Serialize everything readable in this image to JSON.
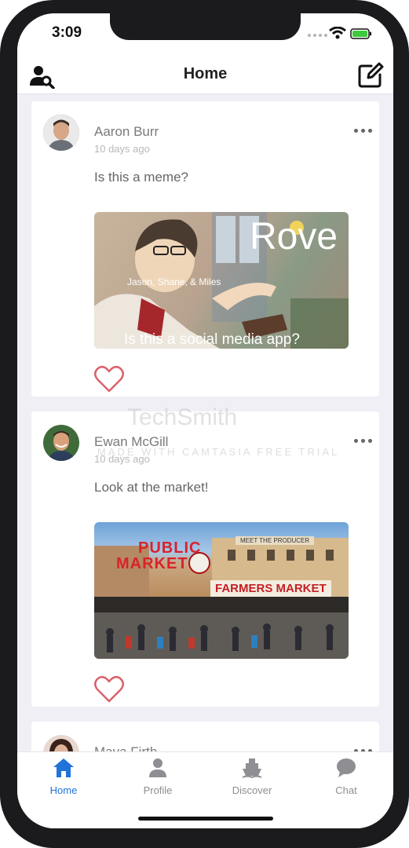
{
  "status": {
    "time": "3:09"
  },
  "nav": {
    "title": "Home",
    "left_icon": "user-search-icon",
    "right_icon": "compose-icon"
  },
  "posts": [
    {
      "author": "Aaron Burr",
      "time": "10 days ago",
      "text": "Is this a meme?",
      "image": {
        "title": "Rove",
        "names": "Jason, Shane, & Miles",
        "caption": "Is this a social media app?"
      }
    },
    {
      "author": "Ewan McGill",
      "time": "10 days ago",
      "text": "Look at the market!",
      "image": {
        "sign_line1": "PUBLIC",
        "sign_line2": "MARKET",
        "banner": "FARMERS MARKET",
        "roof_sign": "MEET THE PRODUCER"
      }
    },
    {
      "author": "Maya Firth"
    }
  ],
  "watermark": {
    "brand": "TechSmith",
    "sub": "MADE WITH CAMTASIA FREE TRIAL"
  },
  "tabs": [
    {
      "label": "Home",
      "icon": "home-icon",
      "active": true
    },
    {
      "label": "Profile",
      "icon": "person-icon",
      "active": false
    },
    {
      "label": "Discover",
      "icon": "ship-icon",
      "active": false
    },
    {
      "label": "Chat",
      "icon": "chat-bubble-icon",
      "active": false
    }
  ],
  "colors": {
    "accent": "#1f73d9",
    "heart": "#d9636b",
    "background": "#f0eff5"
  }
}
